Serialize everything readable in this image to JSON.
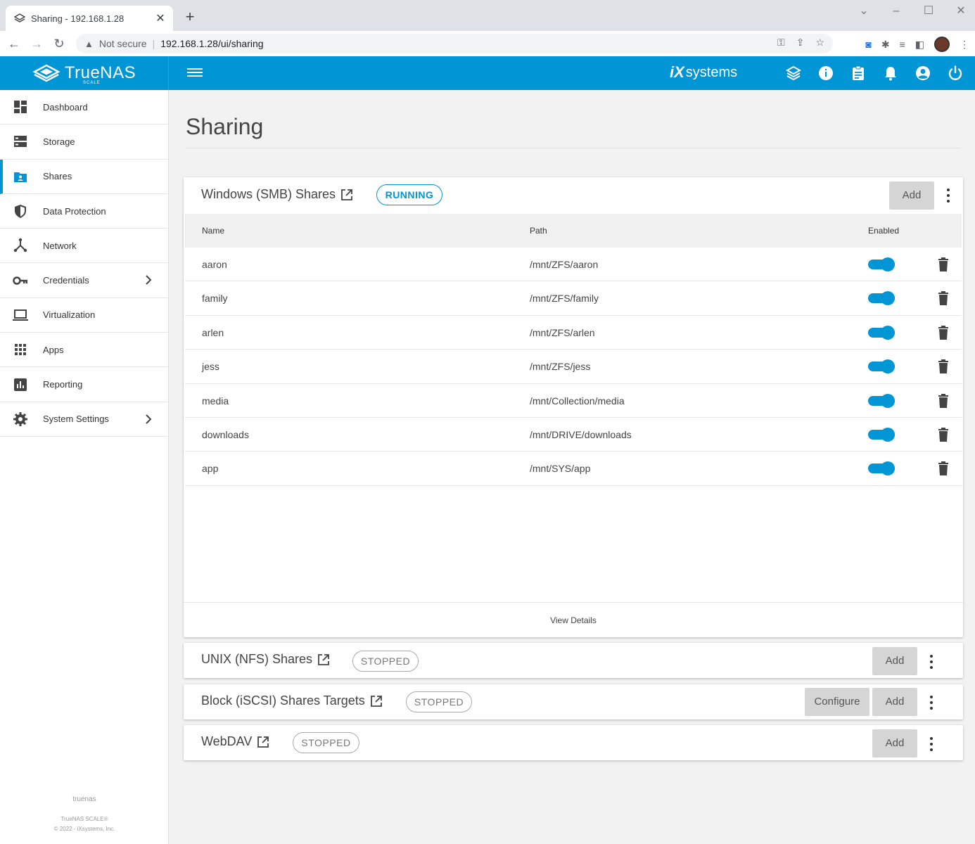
{
  "browser": {
    "tab_title": "Sharing - 192.168.1.28",
    "tab_close": "✕",
    "new_tab": "+",
    "not_secure": "Not secure",
    "url": "192.168.1.28/ui/sharing"
  },
  "app": {
    "brand": "TrueNAS",
    "brand_sub": "SCALE",
    "vendor": "systems",
    "vendor_mark": "iX",
    "accent_color": "#0095d5"
  },
  "sidebar": {
    "items": [
      {
        "label": "Dashboard",
        "icon": "dashboard-icon"
      },
      {
        "label": "Storage",
        "icon": "storage-icon"
      },
      {
        "label": "Shares",
        "icon": "shares-icon",
        "active": true
      },
      {
        "label": "Data Protection",
        "icon": "shield-icon"
      },
      {
        "label": "Network",
        "icon": "network-icon"
      },
      {
        "label": "Credentials",
        "icon": "key-icon",
        "has_children": true
      },
      {
        "label": "Virtualization",
        "icon": "laptop-icon"
      },
      {
        "label": "Apps",
        "icon": "apps-grid-icon"
      },
      {
        "label": "Reporting",
        "icon": "reporting-icon"
      },
      {
        "label": "System Settings",
        "icon": "gear-icon",
        "has_children": true
      }
    ],
    "hostname": "truenas",
    "version": "TrueNAS SCALE®",
    "copyright": "© 2022 - iXsystems, Inc."
  },
  "page": {
    "title": "Sharing"
  },
  "smb": {
    "title": "Windows (SMB) Shares",
    "status": "RUNNING",
    "add_label": "Add",
    "columns": {
      "name": "Name",
      "path": "Path",
      "enabled": "Enabled"
    },
    "rows": [
      {
        "name": "aaron",
        "path": "/mnt/ZFS/aaron",
        "enabled": true
      },
      {
        "name": "family",
        "path": "/mnt/ZFS/family",
        "enabled": true
      },
      {
        "name": "arlen",
        "path": "/mnt/ZFS/arlen",
        "enabled": true
      },
      {
        "name": "jess",
        "path": "/mnt/ZFS/jess",
        "enabled": true
      },
      {
        "name": "media",
        "path": "/mnt/Collection/media",
        "enabled": true
      },
      {
        "name": "downloads",
        "path": "/mnt/DRIVE/downloads",
        "enabled": true
      },
      {
        "name": "app",
        "path": "/mnt/SYS/app",
        "enabled": true
      }
    ],
    "view_details": "View Details"
  },
  "nfs": {
    "title": "UNIX (NFS) Shares",
    "status": "STOPPED",
    "add_label": "Add"
  },
  "iscsi": {
    "title": "Block (iSCSI) Shares Targets",
    "status": "STOPPED",
    "configure_label": "Configure",
    "add_label": "Add"
  },
  "webdav": {
    "title": "WebDAV",
    "status": "STOPPED",
    "add_label": "Add"
  }
}
